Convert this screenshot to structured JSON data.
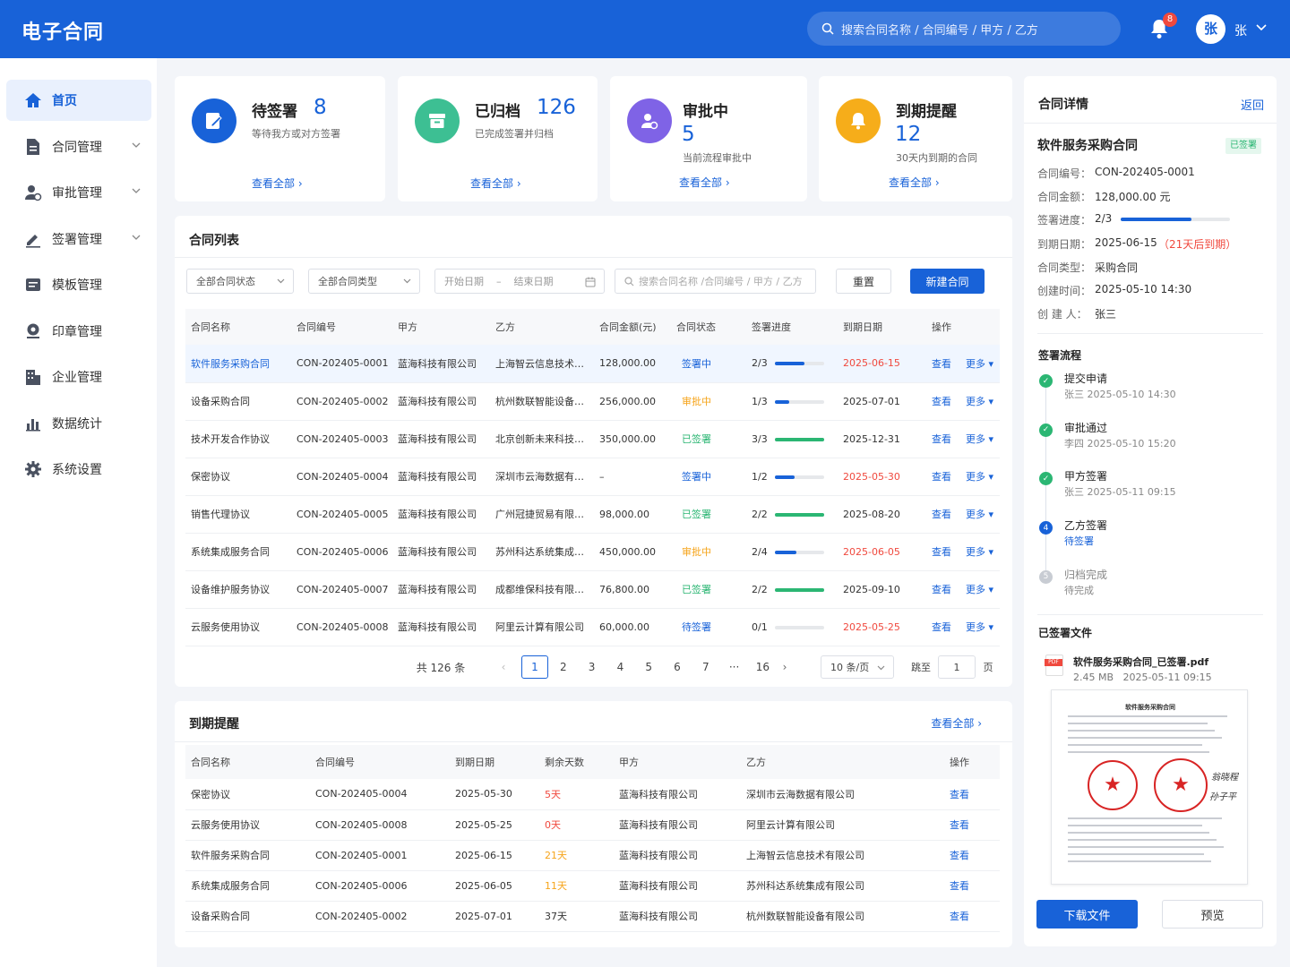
{
  "header": {
    "app_title": "电子合同",
    "search_placeholder": "搜索合同名称 / 合同编号 / 甲方 / 乙方",
    "notification_count": "8",
    "avatar_char": "张",
    "user_name": "张"
  },
  "sidebar": {
    "items": [
      {
        "label": "首页",
        "icon": "home-icon",
        "active": true
      },
      {
        "label": "合同管理",
        "icon": "document-icon",
        "expandable": true
      },
      {
        "label": "审批管理",
        "icon": "approver-icon",
        "expandable": true
      },
      {
        "label": "签署管理",
        "icon": "pen-icon",
        "expandable": true
      },
      {
        "label": "模板管理",
        "icon": "template-icon"
      },
      {
        "label": "印章管理",
        "icon": "seal-icon"
      },
      {
        "label": "企业管理",
        "icon": "building-icon"
      },
      {
        "label": "数据统计",
        "icon": "chart-icon"
      },
      {
        "label": "系统设置",
        "icon": "gear-icon"
      }
    ]
  },
  "kpis": [
    {
      "title": "待签署",
      "value": "8",
      "subtitle": "等待我方或对方签署",
      "link": "查看全部",
      "color": "#1862d8"
    },
    {
      "title": "已归档",
      "value": "126",
      "subtitle": "已完成签署并归档",
      "link": "查看全部",
      "color": "#3dbf93"
    },
    {
      "title": "审批中",
      "value": "5",
      "subtitle": "当前流程审批中",
      "link": "查看全部",
      "color": "#7f63e6"
    },
    {
      "title": "到期提醒",
      "value": "12",
      "subtitle": "30天内到期的合同",
      "link": "查看全部",
      "color": "#f6ad1a"
    }
  ],
  "contract_list": {
    "title": "合同列表",
    "filters": {
      "status": "全部合同状态",
      "type": "全部合同类型",
      "start_date": "开始日期",
      "date_sep": "–",
      "end_date": "结束日期",
      "search_placeholder": "搜索合同名称 /合同编号 / 甲方 / 乙方",
      "reset": "重置",
      "new": "新建合同"
    },
    "columns": [
      "合同名称",
      "合同编号",
      "甲方",
      "乙方",
      "合同金额(元)",
      "合同状态",
      "签署进度",
      "到期日期",
      "操作"
    ],
    "rows": [
      {
        "name": "软件服务采购合同",
        "code": "CON-202405-0001",
        "party_a": "蓝海科技有限公司",
        "party_b": "上海智云信息技术…",
        "amount": "128,000.00",
        "status": "签署中",
        "progress": "2/3",
        "ratio": 0.6,
        "date": "2025-06-15",
        "date_red": true,
        "view": "查看",
        "more": "更多"
      },
      {
        "name": "设备采购合同",
        "code": "CON-202405-0002",
        "party_a": "蓝海科技有限公司",
        "party_b": "杭州数联智能设备…",
        "amount": "256,000.00",
        "status": "审批中",
        "progress": "1/3",
        "ratio": 0.3,
        "date": "2025-07-01",
        "date_red": false,
        "view": "查看",
        "more": "更多"
      },
      {
        "name": "技术开发合作协议",
        "code": "CON-202405-0003",
        "party_a": "蓝海科技有限公司",
        "party_b": "北京创新未来科技…",
        "amount": "350,000.00",
        "status": "已签署",
        "progress": "3/3",
        "ratio": 1,
        "date": "2025-12-31",
        "date_red": false,
        "view": "查看",
        "more": "更多"
      },
      {
        "name": "保密协议",
        "code": "CON-202405-0004",
        "party_a": "蓝海科技有限公司",
        "party_b": "深圳市云海数据有…",
        "amount": "–",
        "status": "签署中",
        "progress": "1/2",
        "ratio": 0.4,
        "date": "2025-05-30",
        "date_red": true,
        "view": "查看",
        "more": "更多"
      },
      {
        "name": "销售代理协议",
        "code": "CON-202405-0005",
        "party_a": "蓝海科技有限公司",
        "party_b": "广州冠捷贸易有限…",
        "amount": "98,000.00",
        "status": "已签署",
        "progress": "2/2",
        "ratio": 1,
        "date": "2025-08-20",
        "date_red": false,
        "view": "查看",
        "more": "更多"
      },
      {
        "name": "系统集成服务合同",
        "code": "CON-202405-0006",
        "party_a": "蓝海科技有限公司",
        "party_b": "苏州科达系统集成…",
        "amount": "450,000.00",
        "status": "审批中",
        "progress": "2/4",
        "ratio": 0.45,
        "date": "2025-06-05",
        "date_red": true,
        "view": "查看",
        "more": "更多"
      },
      {
        "name": "设备维护服务协议",
        "code": "CON-202405-0007",
        "party_a": "蓝海科技有限公司",
        "party_b": "成都维保科技有限…",
        "amount": "76,800.00",
        "status": "已签署",
        "progress": "2/2",
        "ratio": 1,
        "date": "2025-09-10",
        "date_red": false,
        "view": "查看",
        "more": "更多"
      },
      {
        "name": "云服务使用协议",
        "code": "CON-202405-0008",
        "party_a": "蓝海科技有限公司",
        "party_b": "阿里云计算有限公司",
        "amount": "60,000.00",
        "status": "待签署",
        "progress": "0/1",
        "ratio": 0,
        "date": "2025-05-25",
        "date_red": true,
        "view": "查看",
        "more": "更多"
      }
    ],
    "status_colors": {
      "签署中": "#1862d8",
      "审批中": "#f6a41a",
      "已签署": "#2bb673",
      "待签署": "#1862d8"
    },
    "pagination": {
      "total": "共 126 条",
      "pages": [
        "1",
        "2",
        "3",
        "4",
        "5",
        "6",
        "7",
        "···",
        "16"
      ],
      "page_size": "10 条/页",
      "goto_label": "跳至",
      "goto_value": "1",
      "page_suffix": "页"
    }
  },
  "expiry": {
    "title": "到期提醒",
    "view_all": "查看全部",
    "columns": [
      "合同名称",
      "合同编号",
      "到期日期",
      "剩余天数",
      "甲方",
      "乙方",
      "操作"
    ],
    "rows": [
      {
        "name": "保密协议",
        "code": "CON-202405-0004",
        "date": "2025-05-30",
        "days": "5天",
        "days_color": "#f0493e",
        "party_a": "蓝海科技有限公司",
        "party_b": "深圳市云海数据有限公司",
        "action": "查看"
      },
      {
        "name": "云服务使用协议",
        "code": "CON-202405-0008",
        "date": "2025-05-25",
        "days": "0天",
        "days_color": "#f0493e",
        "party_a": "蓝海科技有限公司",
        "party_b": "阿里云计算有限公司",
        "action": "查看"
      },
      {
        "name": "软件服务采购合同",
        "code": "CON-202405-0001",
        "date": "2025-06-15",
        "days": "21天",
        "days_color": "#f6a41a",
        "party_a": "蓝海科技有限公司",
        "party_b": "上海智云信息技术有限公司",
        "action": "查看"
      },
      {
        "name": "系统集成服务合同",
        "code": "CON-202405-0006",
        "date": "2025-06-05",
        "days": "11天",
        "days_color": "#f6a41a",
        "party_a": "蓝海科技有限公司",
        "party_b": "苏州科达系统集成有限公司",
        "action": "查看"
      },
      {
        "name": "设备采购合同",
        "code": "CON-202405-0002",
        "date": "2025-07-01",
        "days": "37天",
        "days_color": "#333333",
        "party_a": "蓝海科技有限公司",
        "party_b": "杭州数联智能设备有限公司",
        "action": "查看"
      }
    ]
  },
  "detail": {
    "title": "合同详情",
    "back": "返回",
    "contract_name": "软件服务采购合同",
    "status_badge": "已签署",
    "fields": [
      {
        "label": "合同编号：",
        "value": "CON-202405-0001"
      },
      {
        "label": "合同金额：",
        "value": "128,000.00 元"
      },
      {
        "label": "签署进度：",
        "value": "2/3"
      },
      {
        "label": "到期日期：",
        "value": "2025-06-15"
      },
      {
        "label": "合同类型：",
        "value": "采购合同"
      },
      {
        "label": "创建时间：",
        "value": "2025-05-10 14:30"
      },
      {
        "label": "创 建 人：",
        "value": "张三"
      }
    ],
    "sign_progress_ratio": 0.65,
    "due_note": "（21天后到期）",
    "flow_title": "签署流程",
    "steps": [
      {
        "title": "提交申请",
        "sub": "张三   2025-05-10 14:30",
        "state": "done"
      },
      {
        "title": "审批通过",
        "sub": "李四   2025-05-10 15:20",
        "state": "done"
      },
      {
        "title": "甲方签署",
        "sub": "张三   2025-05-11 09:15",
        "state": "done"
      },
      {
        "title": "乙方签署",
        "sub": "待签署",
        "state": "current",
        "num": "4"
      },
      {
        "title": "归档完成",
        "sub": "待完成",
        "state": "pending",
        "num": "5"
      }
    ],
    "files_title": "已签署文件",
    "file": {
      "badge": "PDF",
      "name": "软件服务采购合同_已签署.pdf",
      "size": "2.45 MB",
      "date": "2025-05-11 09:15"
    },
    "doc_preview": {
      "heading": "软件服务采购合同",
      "seal_star": "★",
      "signature_1": "翁晓程",
      "signature_2": "孙子平"
    },
    "download": "下载文件",
    "preview": "预览"
  }
}
